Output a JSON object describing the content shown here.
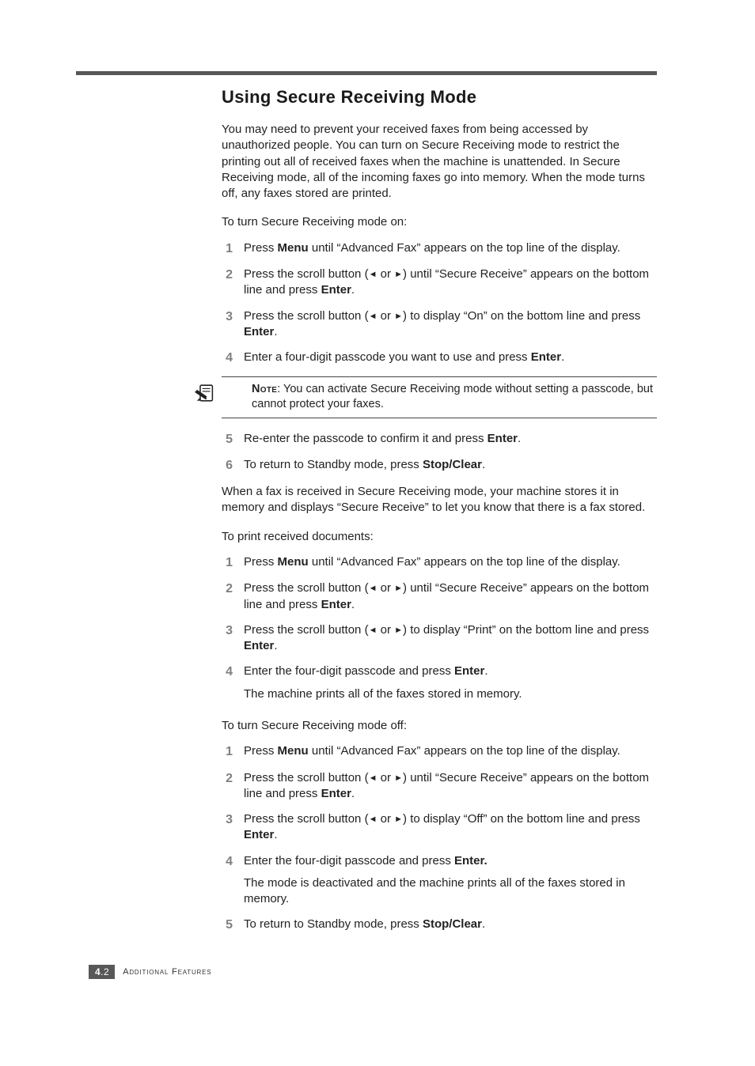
{
  "heading": "Using Secure Receiving Mode",
  "intro": "You may need to prevent your received faxes from being accessed by unauthorized people. You can turn on Secure Receiving mode to restrict the printing out all of received faxes when the machine is unattended. In Secure Receiving mode, all of the incoming faxes go into memory. When the mode turns off, any faxes stored are printed.",
  "section_on": {
    "lead": "To turn Secure Receiving mode on:",
    "steps": [
      {
        "n": "1",
        "pre": "Press ",
        "b1": "Menu",
        "post": " until “Advanced Fax” appears on the top line of the display."
      },
      {
        "n": "2",
        "pre": "Press the scroll button (",
        "tri_l": "◄",
        "mid": " or ",
        "tri_r": "►",
        "post1": ") until “Secure Receive” appears on the bottom line and press ",
        "b1": "Enter",
        "post2": "."
      },
      {
        "n": "3",
        "pre": "Press the scroll button (",
        "tri_l": "◄",
        "mid": " or ",
        "tri_r": "►",
        "post1": ") to display “On” on the bottom line and press ",
        "b1": "Enter",
        "post2": "."
      },
      {
        "n": "4",
        "pre": "Enter a four-digit passcode you want to use and press ",
        "b1": "Enter",
        "post": "."
      }
    ]
  },
  "note": {
    "label": "Note",
    "text": ": You can activate Secure Receiving mode without setting a passcode, but cannot protect your faxes."
  },
  "section_on2": {
    "steps": [
      {
        "n": "5",
        "pre": "Re-enter the passcode to confirm it and press ",
        "b1": "Enter",
        "post": "."
      },
      {
        "n": "6",
        "pre": "To return to Standby mode, press ",
        "b1": "Stop/Clear",
        "post": "."
      }
    ]
  },
  "after_on": "When a fax is received in Secure Receiving mode, your machine stores it in memory and displays “Secure Receive” to let you know that there is a fax stored.",
  "section_print": {
    "lead": "To print received documents:",
    "steps": [
      {
        "n": "1",
        "pre": "Press ",
        "b1": "Menu",
        "post": " until “Advanced Fax” appears on the top line of the display."
      },
      {
        "n": "2",
        "pre": "Press the scroll button (",
        "tri_l": "◄",
        "mid": " or ",
        "tri_r": "►",
        "post1": ") until “Secure Receive” appears on the bottom line and press ",
        "b1": "Enter",
        "post2": "."
      },
      {
        "n": "3",
        "pre": "Press the scroll button (",
        "tri_l": "◄",
        "mid": " or ",
        "tri_r": "►",
        "post1": ") to display “Print” on the bottom line and press ",
        "b1": "Enter",
        "post2": "."
      },
      {
        "n": "4",
        "pre": "Enter the four-digit passcode and press ",
        "b1": "Enter",
        "post": ".",
        "sub": "The machine prints all of the faxes stored in memory."
      }
    ]
  },
  "section_off": {
    "lead": "To turn Secure Receiving mode off:",
    "steps": [
      {
        "n": "1",
        "pre": "Press ",
        "b1": "Menu",
        "post": " until “Advanced Fax” appears on the top line of the display."
      },
      {
        "n": "2",
        "pre": "Press the scroll button (",
        "tri_l": "◄",
        "mid": " or ",
        "tri_r": "►",
        "post1": ") until “Secure Receive” appears on the bottom line and press ",
        "b1": "Enter",
        "post2": "."
      },
      {
        "n": "3",
        "pre": "Press the scroll button (",
        "tri_l": "◄",
        "mid": " or ",
        "tri_r": "►",
        "post1": ") to display “Off” on the bottom line and press ",
        "b1": "Enter",
        "post2": "."
      },
      {
        "n": "4",
        "pre": "Enter the four-digit passcode and press ",
        "b1": "Enter.",
        "post": "",
        "sub": "The mode is deactivated and the machine prints all of the faxes stored in memory."
      },
      {
        "n": "5",
        "pre": "To return to Standby mode, press ",
        "b1": "Stop/Clear",
        "post": "."
      }
    ]
  },
  "footer": {
    "chapter": "4",
    "page": ".2",
    "title": "Additional Features"
  }
}
